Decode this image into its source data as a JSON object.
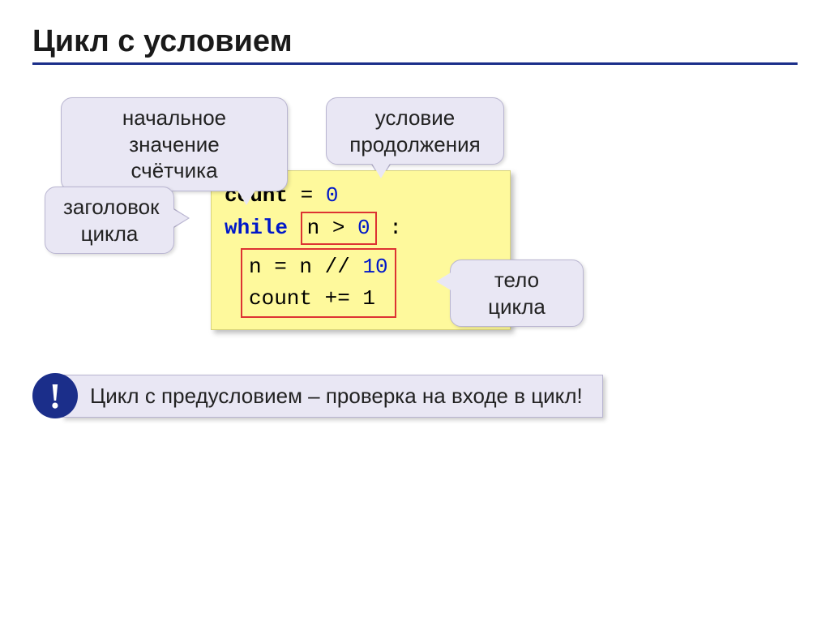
{
  "title": "Цикл с условием",
  "callouts": {
    "counter": {
      "line1": "начальное значение",
      "line2": "счётчика"
    },
    "condition": {
      "line1": "условие",
      "line2": "продолжения"
    },
    "header": {
      "line1": "заголовок",
      "line2": "цикла"
    },
    "body": {
      "text": "тело цикла"
    }
  },
  "code": {
    "l1_var": "count",
    "l1_eq": " = ",
    "l1_zero": "0",
    "l2_while": "while",
    "l2_cond_lhs": "n > ",
    "l2_cond_zero": "0",
    "l2_colon": " :",
    "l3_lhs": "n = n // ",
    "l3_ten": "10",
    "l4": "count += 1"
  },
  "note": {
    "icon": "!",
    "text": "Цикл с предусловием – проверка на входе в цикл!"
  }
}
